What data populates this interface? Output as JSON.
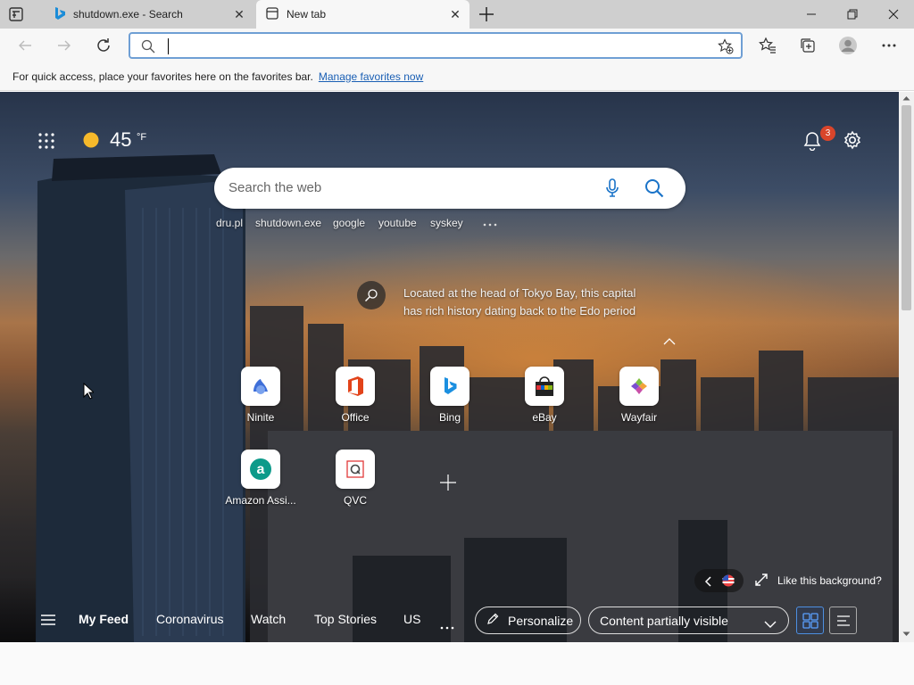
{
  "tabs": [
    {
      "title": "shutdown.exe - Search",
      "icon": "bing-icon"
    },
    {
      "title": "New tab",
      "icon": "new-tab-icon"
    }
  ],
  "address": {
    "value": "",
    "placeholder": ""
  },
  "favorites_bar": {
    "message": "For quick access, place your favorites here on the favorites bar.",
    "link": "Manage favorites now"
  },
  "weather": {
    "temp": "45",
    "unit": "°F",
    "icon": "sun-icon"
  },
  "notifications": {
    "count": "3"
  },
  "search": {
    "placeholder": "Search the web"
  },
  "recent_searches": [
    "dru.pl",
    "shutdown.exe",
    "google",
    "youtube",
    "syskey"
  ],
  "image_info": {
    "text": "Located at the head of Tokyo Bay, this capital has rich history dating back to the Edo period"
  },
  "quick_links": [
    {
      "label": "Ninite"
    },
    {
      "label": "Office"
    },
    {
      "label": "Bing"
    },
    {
      "label": "eBay"
    },
    {
      "label": "Wayfair"
    },
    {
      "label": "Amazon Assi..."
    },
    {
      "label": "QVC"
    }
  ],
  "background": {
    "like_label": "Like this background?"
  },
  "feed": {
    "tabs": [
      "My Feed",
      "Coronavirus",
      "Watch",
      "Top Stories",
      "US"
    ],
    "personalize": "Personalize",
    "visibility": "Content partially visible"
  }
}
